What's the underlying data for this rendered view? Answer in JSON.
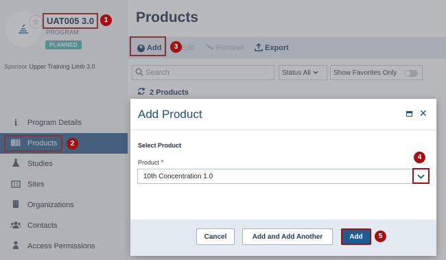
{
  "sidebar": {
    "program_title": "UAT005 3.0",
    "program_type": "PROGRAM",
    "status": "PLANNED",
    "sponsor_label": "Sponsor",
    "sponsor_value": "Upper Training Limb 3.0",
    "nav": [
      {
        "label": "Program Details",
        "icon": "info-icon"
      },
      {
        "label": "Products",
        "icon": "barcode-icon"
      },
      {
        "label": "Studies",
        "icon": "flask-icon"
      },
      {
        "label": "Sites",
        "icon": "building-icon"
      },
      {
        "label": "Organizations",
        "icon": "organization-icon"
      },
      {
        "label": "Contacts",
        "icon": "people-icon"
      },
      {
        "label": "Access Permissions",
        "icon": "person-key-icon"
      }
    ]
  },
  "main": {
    "title": "Products",
    "toolbar": {
      "add": "Add",
      "edit": "Edit",
      "remove": "Remove",
      "export": "Export"
    },
    "search_placeholder": "Search",
    "status_filter": "Status All",
    "favorites_toggle": "Show Favorites Only",
    "count": "2 Products"
  },
  "dialog": {
    "title": "Add Product",
    "section": "Select Product",
    "field_label": "Product",
    "required_mark": "*",
    "field_value": "10th Concentration 1.0",
    "cancel": "Cancel",
    "add_another": "Add and Add Another",
    "add": "Add"
  },
  "callouts": [
    "1",
    "2",
    "3",
    "4",
    "5"
  ],
  "colors": {
    "accent": "#2e5d8a",
    "primary_button": "#1d5c91",
    "callout": "#a50f0f",
    "planned_badge": "#4fb3ab"
  }
}
